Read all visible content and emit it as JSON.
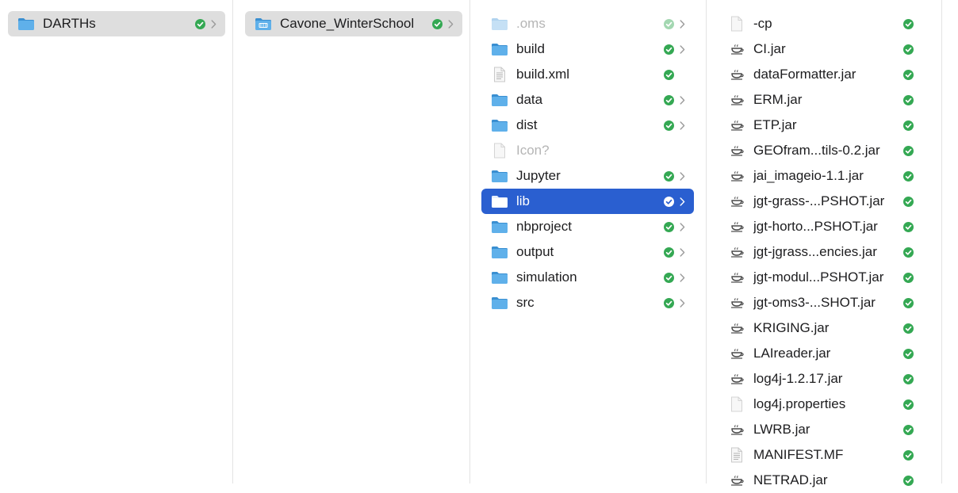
{
  "colors": {
    "folder": "#5fb0ea",
    "folder_dark": "#3a8fd1",
    "sync_ok": "#34a853",
    "selection": "#2a5fd0",
    "parent_selection": "#dedede"
  },
  "columns": [
    {
      "items": [
        {
          "label": "DARTHs",
          "icon": "folder-icon",
          "status": "synced",
          "chevron": true,
          "state": "parent-selected"
        }
      ]
    },
    {
      "items": [
        {
          "label": "Cavone_WinterSchool",
          "icon": "app-folder-icon",
          "status": "synced",
          "chevron": true,
          "state": "parent-selected"
        }
      ]
    },
    {
      "items": [
        {
          "label": ".oms",
          "icon": "folder-icon",
          "status": "synced",
          "chevron": true,
          "state": "dim"
        },
        {
          "label": "build",
          "icon": "folder-icon",
          "status": "synced",
          "chevron": true
        },
        {
          "label": "build.xml",
          "icon": "text-file-icon",
          "status": "synced",
          "chevron": false
        },
        {
          "label": "data",
          "icon": "folder-icon",
          "status": "synced",
          "chevron": true
        },
        {
          "label": "dist",
          "icon": "folder-icon",
          "status": "synced",
          "chevron": true
        },
        {
          "label": "Icon?",
          "icon": "blank-file-icon",
          "status": "none",
          "chevron": false,
          "state": "dim"
        },
        {
          "label": "Jupyter",
          "icon": "folder-icon",
          "status": "synced",
          "chevron": true
        },
        {
          "label": "lib",
          "icon": "folder-icon",
          "status": "synced",
          "chevron": true,
          "state": "active"
        },
        {
          "label": "nbproject",
          "icon": "folder-icon",
          "status": "synced",
          "chevron": true
        },
        {
          "label": "output",
          "icon": "folder-icon",
          "status": "synced",
          "chevron": true
        },
        {
          "label": "simulation",
          "icon": "folder-icon",
          "status": "synced",
          "chevron": true
        },
        {
          "label": "src",
          "icon": "folder-icon",
          "status": "synced",
          "chevron": true
        }
      ]
    },
    {
      "items": [
        {
          "label": "-cp",
          "icon": "blank-file-icon",
          "status": "synced"
        },
        {
          "label": "CI.jar",
          "icon": "jar-icon",
          "status": "synced"
        },
        {
          "label": "dataFormatter.jar",
          "icon": "jar-icon",
          "status": "synced"
        },
        {
          "label": "ERM.jar",
          "icon": "jar-icon",
          "status": "synced"
        },
        {
          "label": "ETP.jar",
          "icon": "jar-icon",
          "status": "synced"
        },
        {
          "label": "GEOfram...tils-0.2.jar",
          "icon": "jar-icon",
          "status": "synced"
        },
        {
          "label": "jai_imageio-1.1.jar",
          "icon": "jar-icon",
          "status": "synced"
        },
        {
          "label": "jgt-grass-...PSHOT.jar",
          "icon": "jar-icon",
          "status": "synced"
        },
        {
          "label": "jgt-horto...PSHOT.jar",
          "icon": "jar-icon",
          "status": "synced"
        },
        {
          "label": "jgt-jgrass...encies.jar",
          "icon": "jar-icon",
          "status": "synced"
        },
        {
          "label": "jgt-modul...PSHOT.jar",
          "icon": "jar-icon",
          "status": "synced"
        },
        {
          "label": "jgt-oms3-...SHOT.jar",
          "icon": "jar-icon",
          "status": "synced"
        },
        {
          "label": "KRIGING.jar",
          "icon": "jar-icon",
          "status": "synced"
        },
        {
          "label": "LAIreader.jar",
          "icon": "jar-icon",
          "status": "synced"
        },
        {
          "label": "log4j-1.2.17.jar",
          "icon": "jar-icon",
          "status": "synced"
        },
        {
          "label": "log4j.properties",
          "icon": "blank-file-icon",
          "status": "synced"
        },
        {
          "label": "LWRB.jar",
          "icon": "jar-icon",
          "status": "synced"
        },
        {
          "label": "MANIFEST.MF",
          "icon": "text-file-icon",
          "status": "synced"
        },
        {
          "label": "NETRAD.jar",
          "icon": "jar-icon",
          "status": "synced"
        }
      ]
    }
  ]
}
